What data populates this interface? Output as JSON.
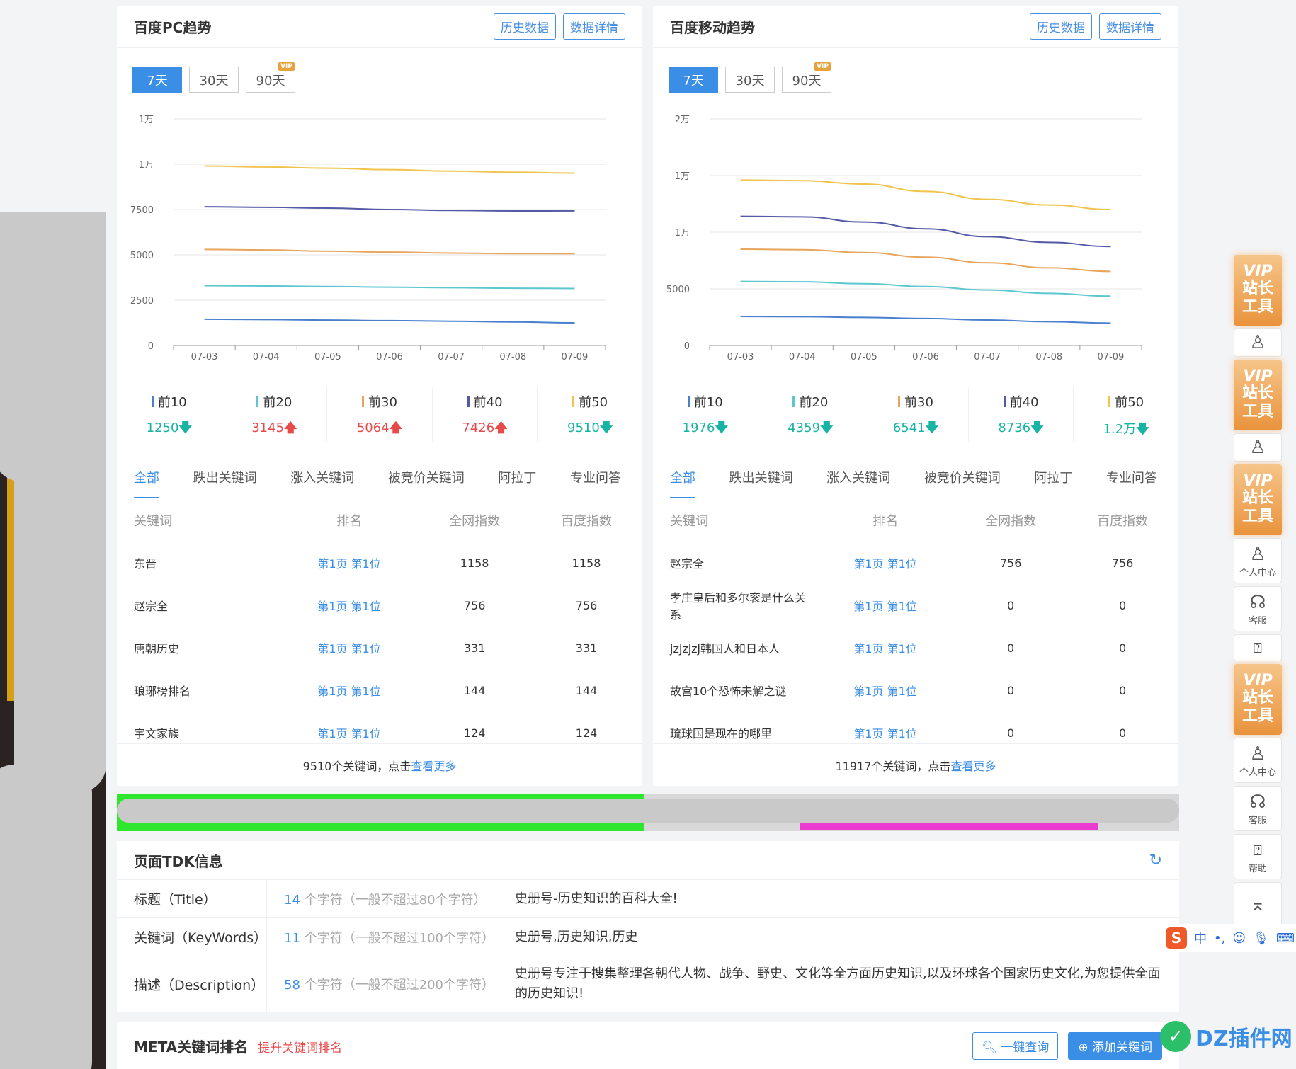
{
  "pc": {
    "title": "百度PC趋势",
    "btn_history": "历史数据",
    "btn_detail": "数据详情",
    "ranges": [
      "7天",
      "30天",
      "90天"
    ],
    "vip_badge": "VIP",
    "chart_data": {
      "type": "line",
      "x": [
        "07-03",
        "07-04",
        "07-05",
        "07-06",
        "07-07",
        "07-08",
        "07-09"
      ],
      "y_ticks": [
        "0",
        "2500",
        "5000",
        "7500",
        "1万",
        "1万"
      ],
      "ylim": [
        0,
        12500
      ],
      "grid": true,
      "series": [
        {
          "name": "前10",
          "color": "#4a7fd0",
          "values": [
            1450,
            1430,
            1400,
            1370,
            1340,
            1300,
            1250
          ]
        },
        {
          "name": "前20",
          "color": "#5cc7cf",
          "values": [
            3300,
            3280,
            3250,
            3220,
            3190,
            3160,
            3145
          ]
        },
        {
          "name": "前30",
          "color": "#e8a55d",
          "values": [
            5300,
            5270,
            5200,
            5150,
            5100,
            5070,
            5064
          ]
        },
        {
          "name": "前40",
          "color": "#555aa6",
          "values": [
            7650,
            7620,
            7580,
            7500,
            7450,
            7420,
            7426
          ]
        },
        {
          "name": "前50",
          "color": "#f0c44c",
          "values": [
            9900,
            9850,
            9780,
            9700,
            9620,
            9560,
            9510
          ]
        }
      ]
    },
    "stats": [
      {
        "label": "前10",
        "value": "1250",
        "dir": "down",
        "arrow": "🡇",
        "color": "#4a7fd0"
      },
      {
        "label": "前20",
        "value": "3145",
        "dir": "up",
        "arrow": "🡅",
        "color": "#5cc7cf"
      },
      {
        "label": "前30",
        "value": "5064",
        "dir": "up",
        "arrow": "🡅",
        "color": "#e8a55d"
      },
      {
        "label": "前40",
        "value": "7426",
        "dir": "up",
        "arrow": "🡅",
        "color": "#555aa6"
      },
      {
        "label": "前50",
        "value": "9510",
        "dir": "down",
        "arrow": "🡇",
        "color": "#f0c44c"
      }
    ],
    "tabs": [
      "全部",
      "跌出关键词",
      "涨入关键词",
      "被竞价关键词",
      "阿拉丁",
      "专业问答"
    ],
    "columns": [
      "关键词",
      "排名",
      "全网指数",
      "百度指数"
    ],
    "rows": [
      [
        "东晋",
        "第1页 第1位",
        "1158",
        "1158"
      ],
      [
        "赵宗全",
        "第1页 第1位",
        "756",
        "756"
      ],
      [
        "唐朝历史",
        "第1页 第1位",
        "331",
        "331"
      ],
      [
        "琅琊榜排名",
        "第1页 第1位",
        "144",
        "144"
      ],
      [
        "宇文家族",
        "第1页 第1位",
        "124",
        "124"
      ]
    ],
    "foot_text": "9510个关键词，点击",
    "foot_link": "查看更多"
  },
  "mobile": {
    "title": "百度移动趋势",
    "btn_history": "历史数据",
    "btn_detail": "数据详情",
    "ranges": [
      "7天",
      "30天",
      "90天"
    ],
    "vip_badge": "VIP",
    "chart_data": {
      "type": "line",
      "x": [
        "07-03",
        "07-04",
        "07-05",
        "07-06",
        "07-07",
        "07-08",
        "07-09"
      ],
      "y_ticks": [
        "0",
        "5000",
        "1万",
        "1万",
        "2万"
      ],
      "ylim": [
        0,
        20000
      ],
      "grid": true,
      "series": [
        {
          "name": "前10",
          "color": "#4a7fd0",
          "values": [
            2560,
            2540,
            2480,
            2380,
            2250,
            2100,
            1976
          ]
        },
        {
          "name": "前20",
          "color": "#5cc7cf",
          "values": [
            5650,
            5620,
            5450,
            5200,
            4900,
            4600,
            4359
          ]
        },
        {
          "name": "前30",
          "color": "#e8a55d",
          "values": [
            8500,
            8450,
            8200,
            7800,
            7300,
            6850,
            6541
          ]
        },
        {
          "name": "前40",
          "color": "#555aa6",
          "values": [
            11400,
            11350,
            10900,
            10300,
            9600,
            9100,
            8736
          ]
        },
        {
          "name": "前50",
          "color": "#f0c44c",
          "values": [
            14600,
            14550,
            14250,
            13600,
            12900,
            12400,
            12000
          ]
        }
      ]
    },
    "stats": [
      {
        "label": "前10",
        "value": "1976",
        "dir": "down",
        "arrow": "🡇",
        "color": "#4a7fd0"
      },
      {
        "label": "前20",
        "value": "4359",
        "dir": "down",
        "arrow": "🡇",
        "color": "#5cc7cf"
      },
      {
        "label": "前30",
        "value": "6541",
        "dir": "down",
        "arrow": "🡇",
        "color": "#e8a55d"
      },
      {
        "label": "前40",
        "value": "8736",
        "dir": "down",
        "arrow": "🡇",
        "color": "#555aa6"
      },
      {
        "label": "前50",
        "value": "1.2万",
        "dir": "down",
        "arrow": "🡇",
        "color": "#f0c44c"
      }
    ],
    "tabs": [
      "全部",
      "跌出关键词",
      "涨入关键词",
      "被竞价关键词",
      "阿拉丁",
      "专业问答"
    ],
    "columns": [
      "关键词",
      "排名",
      "全网指数",
      "百度指数"
    ],
    "rows": [
      [
        "赵宗全",
        "第1页 第1位",
        "756",
        "756"
      ],
      [
        "孝庄皇后和多尔衮是什么关系",
        "第1页 第1位",
        "0",
        "0"
      ],
      [
        "jzjzjzj韩国人和日本人",
        "第1页 第1位",
        "0",
        "0"
      ],
      [
        "故宫10个恐怖未解之谜",
        "第1页 第1位",
        "0",
        "0"
      ],
      [
        "琉球国是现在的哪里",
        "第1页 第1位",
        "0",
        "0"
      ]
    ],
    "foot_text": "11917个关键词，点击",
    "foot_link": "查看更多"
  },
  "tdk": {
    "title": "页面TDK信息",
    "rows": [
      {
        "label": "标题（Title）",
        "count": "14",
        "count_text": " 个字符（一般不超过80个字符）",
        "value": "史册号-历史知识的百科大全!"
      },
      {
        "label": "关键词（KeyWords）",
        "count": "11",
        "count_text": " 个字符（一般不超过100个字符）",
        "value": "史册号,历史知识,历史"
      },
      {
        "label": "描述（Description）",
        "count": "58",
        "count_text": " 个字符（一般不超过200个字符）",
        "value": "史册号专注于搜集整理各朝代人物、战争、野史、文化等全方面历史知识,以及环球各个国家历史文化,为您提供全面的历史知识!"
      }
    ]
  },
  "meta": {
    "title": "META关键词排名",
    "sub": "提升关键词排名",
    "btn_query": "一键查询",
    "btn_add": "添加关键词"
  },
  "sidebar": {
    "vip_v": "VIP",
    "vip_w1": "站长",
    "vip_w2": "工具",
    "user_center": "个人中心",
    "service": "客服",
    "help": "帮助"
  },
  "ime": {
    "s": "S",
    "zh": "中"
  },
  "watermark": {
    "text": "DZ插件网"
  }
}
